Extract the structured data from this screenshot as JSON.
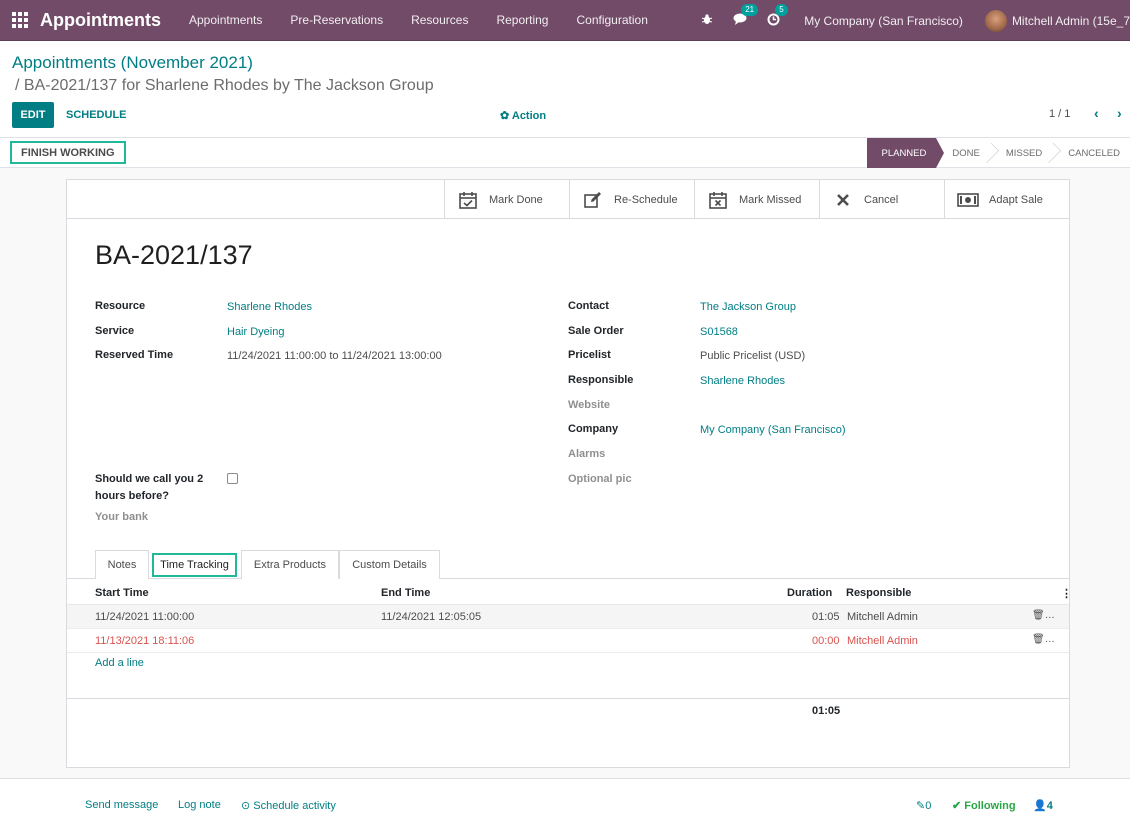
{
  "navbar": {
    "app_name": "Appointments",
    "menu": [
      "Appointments",
      "Pre-Reservations",
      "Resources",
      "Reporting",
      "Configuration"
    ],
    "messages_count": "21",
    "activities_count": "5",
    "company": "My Company (San Francisco)",
    "user": "Mitchell Admin (15e_7"
  },
  "control": {
    "breadcrumb_parent": "Appointments (November 2021)",
    "breadcrumb_current": "/ BA-2021/137 for Sharlene Rhodes by The Jackson Group",
    "edit_label": "EDIT",
    "schedule_label": "SCHEDULE",
    "action_label": "Action",
    "pager": "1 / 1"
  },
  "statusbar": {
    "finish_label": "FINISH WORKING",
    "stages": [
      "PLANNED",
      "DONE",
      "MISSED",
      "CANCELED"
    ],
    "active_stage": "PLANNED"
  },
  "smart_buttons": [
    {
      "label": "Mark Done",
      "icon": "calendar-check-icon"
    },
    {
      "label": "Re-Schedule",
      "icon": "edit-icon"
    },
    {
      "label": "Mark Missed",
      "icon": "calendar-x-icon"
    },
    {
      "label": "Cancel",
      "icon": "close-icon"
    },
    {
      "label": "Adapt Sale",
      "icon": "money-icon"
    }
  ],
  "record": {
    "title": "BA-2021/137",
    "left": {
      "resource_label": "Resource",
      "resource": "Sharlene Rhodes",
      "service_label": "Service",
      "service": "Hair Dyeing",
      "reserved_label": "Reserved Time",
      "reserved": "11/24/2021 11:00:00 to 11/24/2021 13:00:00",
      "call_label_1": "Should we call you 2",
      "call_label_2": "hours before?",
      "bank_label": "Your bank"
    },
    "right": {
      "contact_label": "Contact",
      "contact": "The Jackson Group",
      "sale_label": "Sale Order",
      "sale": "S01568",
      "pricelist_label": "Pricelist",
      "pricelist": "Public Pricelist (USD)",
      "responsible_label": "Responsible",
      "responsible": "Sharlene Rhodes",
      "website_label": "Website",
      "company_label": "Company",
      "company": "My Company (San Francisco)",
      "alarms_label": "Alarms",
      "pic_label": "Optional pic"
    }
  },
  "tabs": [
    "Notes",
    "Time Tracking",
    "Extra Products",
    "Custom Details"
  ],
  "time_tracking": {
    "headers": {
      "start": "Start Time",
      "end": "End Time",
      "duration": "Duration",
      "responsible": "Responsible"
    },
    "rows": [
      {
        "start": "11/24/2021 11:00:00",
        "end": "11/24/2021 12:05:05",
        "duration": "01:05",
        "responsible": "Mitchell Admin"
      },
      {
        "start": "11/13/2021 18:11:06",
        "end": "",
        "duration": "00:00",
        "responsible": "Mitchell Admin"
      }
    ],
    "add_line": "Add a line",
    "total": "01:05"
  },
  "chatter": {
    "send_message": "Send message",
    "log_note": "Log note",
    "schedule_activity": "Schedule activity",
    "attachments": "0",
    "following": "Following",
    "followers": "4"
  }
}
